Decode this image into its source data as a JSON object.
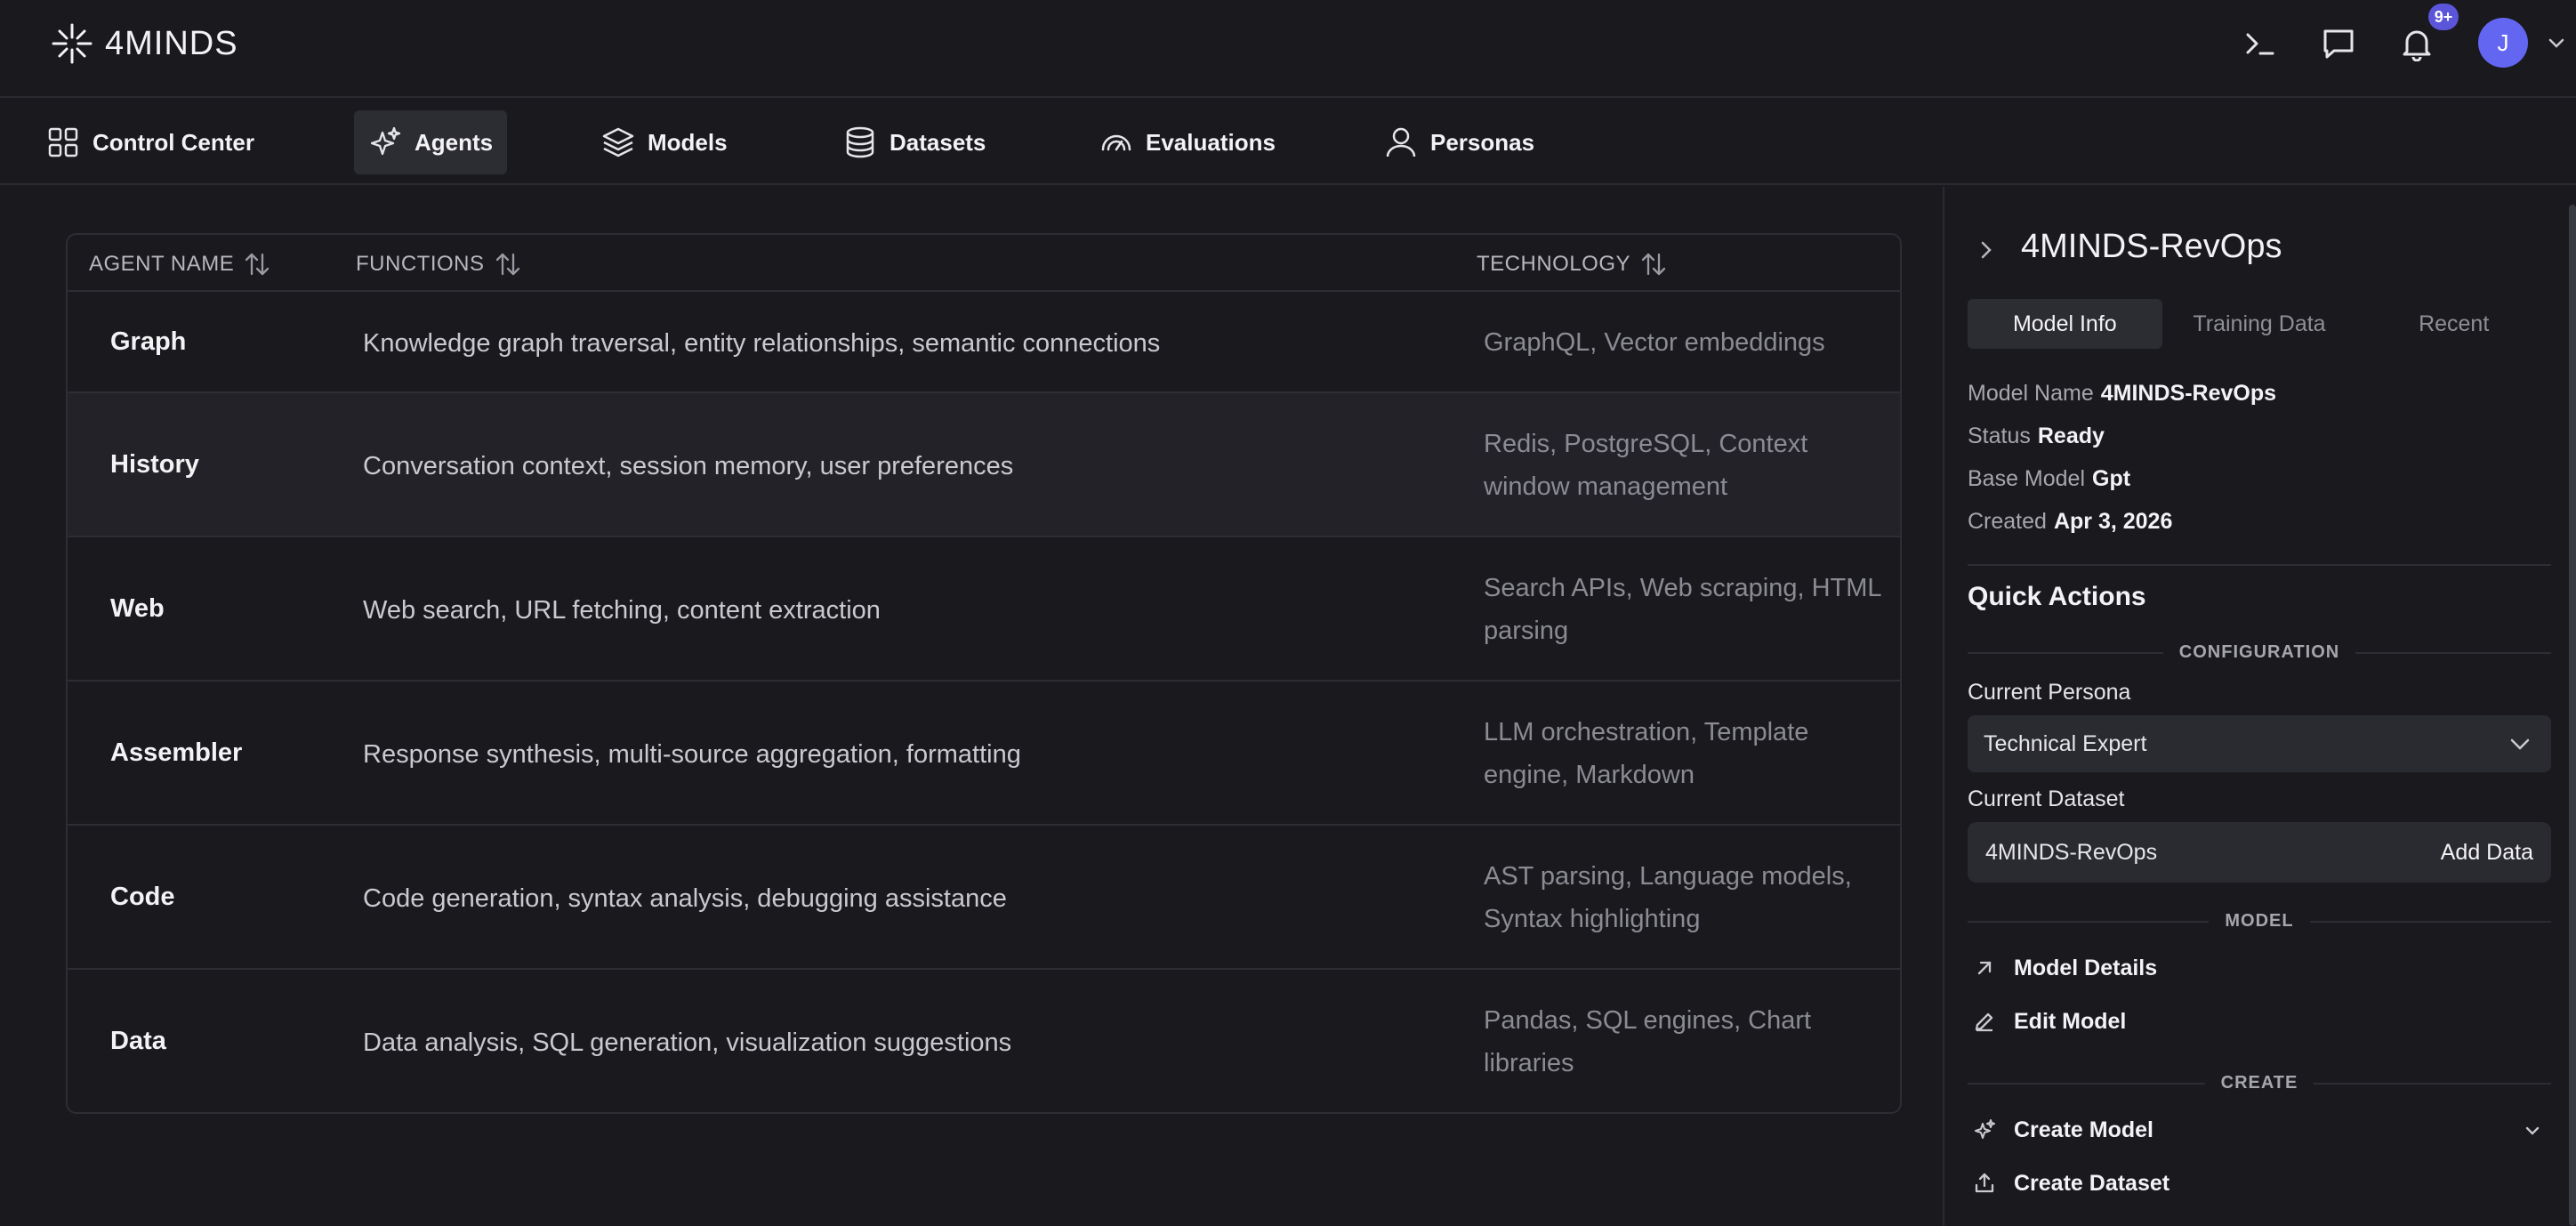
{
  "app": {
    "brand": "4MINDS",
    "notification_count": "9+",
    "avatar_initial": "J"
  },
  "nav": {
    "items": [
      {
        "label": "Control Center",
        "icon": "grid-icon"
      },
      {
        "label": "Agents",
        "icon": "sparkles-icon",
        "active": true
      },
      {
        "label": "Models",
        "icon": "layers-icon"
      },
      {
        "label": "Datasets",
        "icon": "database-icon"
      },
      {
        "label": "Evaluations",
        "icon": "gauge-icon"
      },
      {
        "label": "Personas",
        "icon": "user-icon"
      }
    ]
  },
  "table": {
    "headers": {
      "name": "AGENT NAME",
      "functions": "FUNCTIONS",
      "technology": "TECHNOLOGY"
    },
    "rows": [
      {
        "name": "Graph",
        "functions": "Knowledge graph traversal, entity relationships, semantic connections",
        "technology": "GraphQL, Vector embeddings"
      },
      {
        "name": "History",
        "functions": "Conversation context, session memory, user preferences",
        "technology": "Redis, PostgreSQL, Context window management"
      },
      {
        "name": "Web",
        "functions": "Web search, URL fetching, content extraction",
        "technology": "Search APIs, Web scraping, HTML parsing"
      },
      {
        "name": "Assembler",
        "functions": "Response synthesis, multi-source aggregation, formatting",
        "technology": "LLM orchestration, Template engine, Markdown"
      },
      {
        "name": "Code",
        "functions": "Code generation, syntax analysis, debugging assistance",
        "technology": "AST parsing, Language models, Syntax highlighting"
      },
      {
        "name": "Data",
        "functions": "Data analysis, SQL generation, visualization suggestions",
        "technology": "Pandas, SQL engines, Chart libraries"
      }
    ]
  },
  "panel": {
    "title": "4MINDS-RevOps",
    "tabs": [
      "Model Info",
      "Training Data",
      "Recent"
    ],
    "info": {
      "model_name_label": "Model Name",
      "model_name": "4MINDS-RevOps",
      "status_label": "Status",
      "status": "Ready",
      "base_model_label": "Base Model",
      "base_model": "Gpt",
      "created_label": "Created",
      "created": "Apr 3, 2026"
    },
    "quick_actions_title": "Quick Actions",
    "configuration_label": "CONFIGURATION",
    "current_persona_label": "Current Persona",
    "current_persona": "Technical Expert",
    "current_dataset_label": "Current Dataset",
    "current_dataset": "4MINDS-RevOps",
    "add_data_label": "Add Data",
    "model_group_label": "MODEL",
    "model_details_label": "Model Details",
    "edit_model_label": "Edit Model",
    "create_group_label": "CREATE",
    "create_model_label": "Create Model",
    "create_dataset_label": "Create Dataset"
  }
}
